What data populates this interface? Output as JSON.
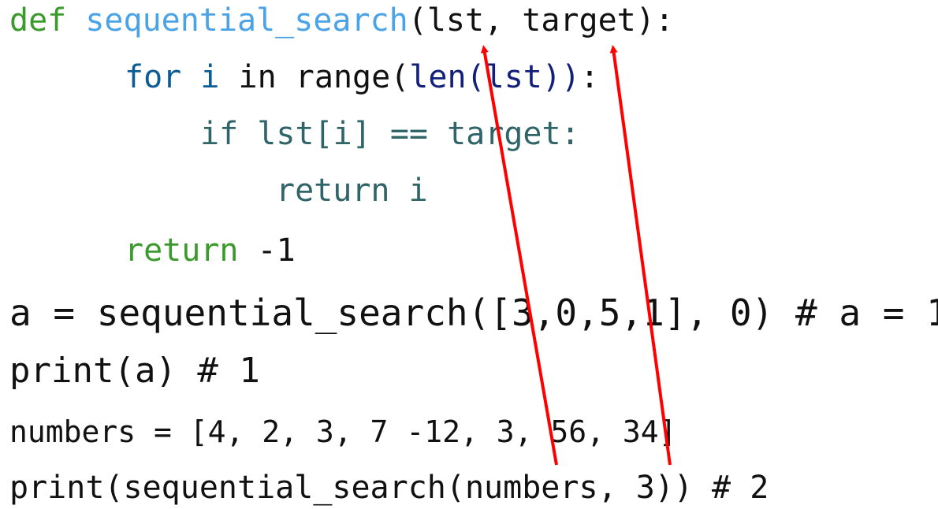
{
  "code": {
    "line1": {
      "kw_def": "def",
      "fn_name": "sequential_search",
      "params": "(lst, target):"
    },
    "line2": {
      "kw_for": "for",
      "var_i": "i",
      "kw_in": "in",
      "range_open": "range(",
      "fn_len": "len(",
      "arg_lst": "lst",
      "close": "))",
      "colon": ":"
    },
    "line3": {
      "text": "if lst[i] == target:"
    },
    "line4": {
      "text": "return i"
    },
    "line5": {
      "kw_return": "return",
      "value": " -1"
    },
    "line6": "a = sequential_search([3,0,5,1], 0) # a = 1",
    "line7": "print(a) # 1",
    "line8": "numbers = [4, 2, 3, 7 -12, 3, 56, 34]",
    "line9": "print(sequential_search(numbers, 3)) # 2"
  },
  "annotation_color": "#ff0000"
}
